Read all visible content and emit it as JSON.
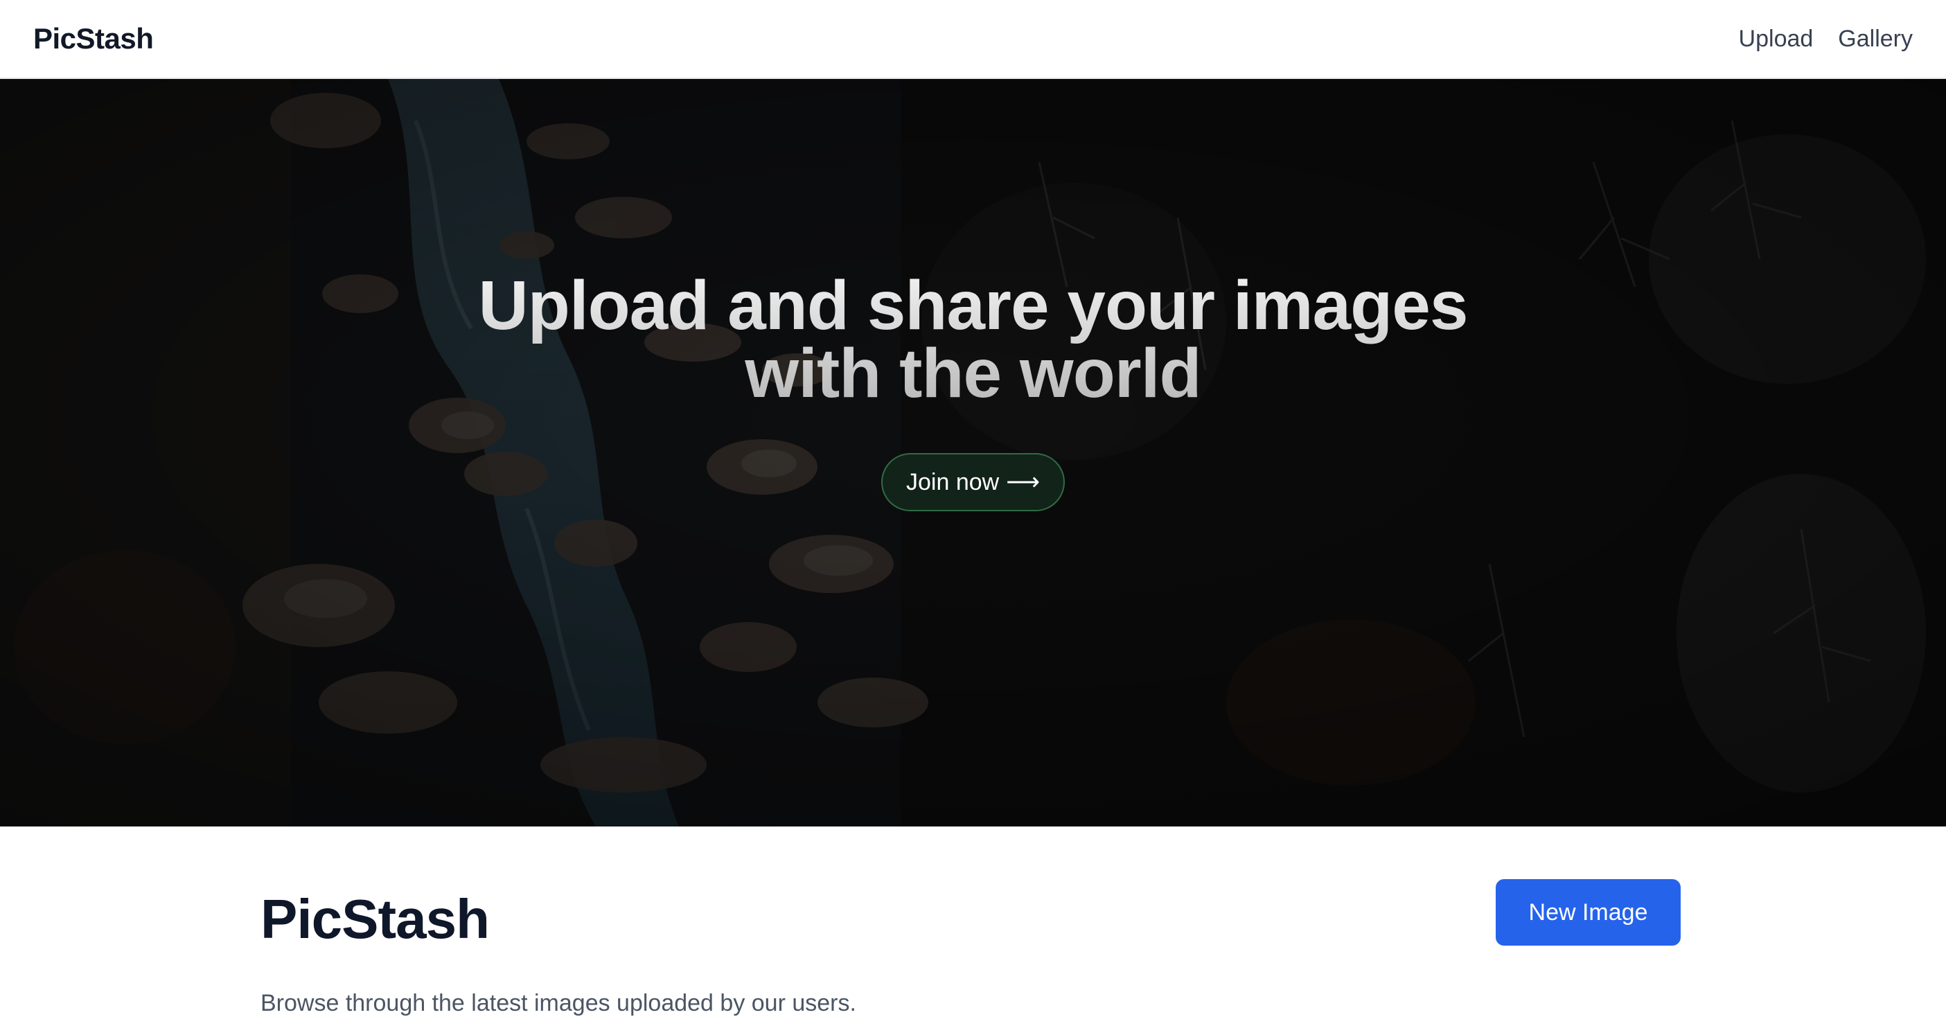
{
  "header": {
    "brand": "PicStash",
    "nav": [
      {
        "label": "Upload"
      },
      {
        "label": "Gallery"
      }
    ]
  },
  "hero": {
    "title_line1": "Upload and share your images",
    "title_line2": "with the world",
    "cta_label": "Join now",
    "cta_icon": "arrow-right-icon"
  },
  "main": {
    "title": "PicStash",
    "new_button_label": "New Image",
    "subtitle": "Browse through the latest images uploaded by our users."
  },
  "colors": {
    "primary": "#2563eb",
    "cta_border": "#2f6b45",
    "text_dark": "#0f172a"
  }
}
